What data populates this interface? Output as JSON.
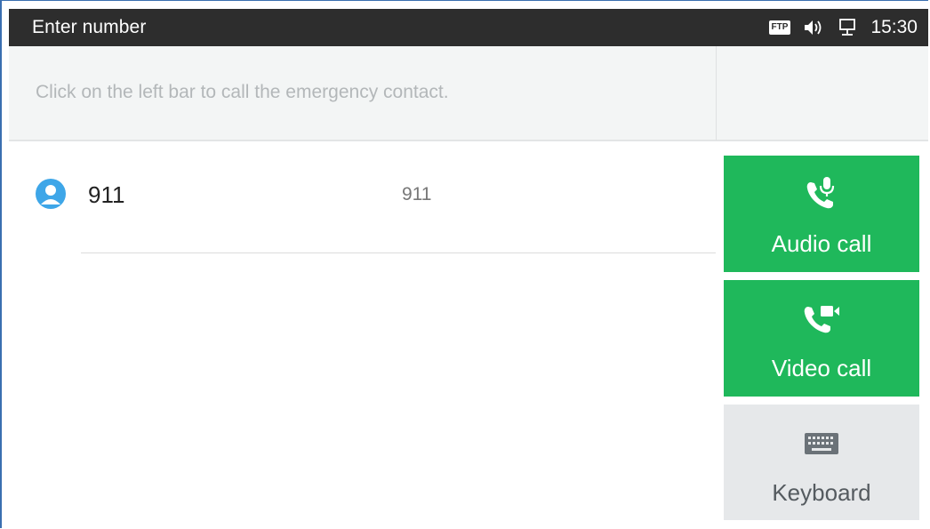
{
  "statusbar": {
    "title": "Enter number",
    "ftp_badge": "FTP",
    "icons": [
      "volume-icon",
      "network-icon"
    ],
    "time": "15:30"
  },
  "input": {
    "hint": "Click on the left bar to call the emergency contact."
  },
  "contacts": [
    {
      "name": "911",
      "number": "911",
      "avatar": "person-icon"
    }
  ],
  "actions": {
    "audio_label": "Audio call",
    "video_label": "Video call",
    "keyboard_label": "Keyboard"
  },
  "colors": {
    "statusbar_bg": "#2d2d2d",
    "call_green": "#1fb85b",
    "keyboard_bg": "#e6e8ea",
    "avatar_blue": "#3ea6e8"
  }
}
